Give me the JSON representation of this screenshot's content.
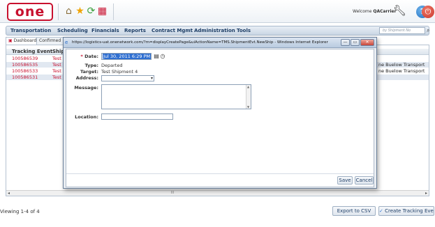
{
  "header": {
    "logo_text": "one",
    "welcome_prefix": "Welcome ",
    "welcome_user": "QACarrier",
    "help_glyph": "?",
    "icons": [
      "home-icon",
      "favorites-star-icon",
      "refresh-icon",
      "reports-icon",
      "wrench-icon",
      "help-icon",
      "power-icon"
    ]
  },
  "nav": {
    "items": [
      "Transportation",
      "Scheduling",
      "Financials",
      "Reports",
      "Contract Mgmt",
      "Administration",
      "Tools"
    ],
    "search_placeholder": "by Shipment No"
  },
  "tabs": [
    {
      "label": "Dashboard"
    },
    {
      "label": "Confirmed"
    }
  ],
  "grid": {
    "headers": [
      "Tracking Event",
      "Shipm"
    ],
    "rows": [
      {
        "event": "100586539",
        "shipment": "Test S",
        "carrier": ""
      },
      {
        "event": "100586535",
        "shipment": "Test S",
        "carrier": "ne Buelow Transport"
      },
      {
        "event": "100586533",
        "shipment": "Test S",
        "carrier": "ne Buelow Transport"
      },
      {
        "event": "100586531",
        "shipment": "Test S",
        "carrier": ""
      }
    ],
    "scroll_thumb": "III"
  },
  "footer": {
    "status": "Viewing 1-4 of 4",
    "export_label": "Export to CSV",
    "create_label": "Create Tracking Event"
  },
  "dialog": {
    "title": "https://logistics-uat.onenetwork.com/?m=displayCreatePage&uiActionName=TMS.ShipmentEvt.NewShip - Windows Internet Explorer",
    "win_min": "—",
    "win_max": "▭",
    "win_close": "✕",
    "date_label": "Date:",
    "date_value": "Jul 30, 2011 6:29 PM",
    "type_label": "Type:",
    "type_value": "Departed",
    "target_label": "Target:",
    "target_value": "Test Shipment 4",
    "address_label": "Address:",
    "message_label": "Message:",
    "location_label": "Location:",
    "save_label": "Save",
    "cancel_label": "Cancel"
  }
}
